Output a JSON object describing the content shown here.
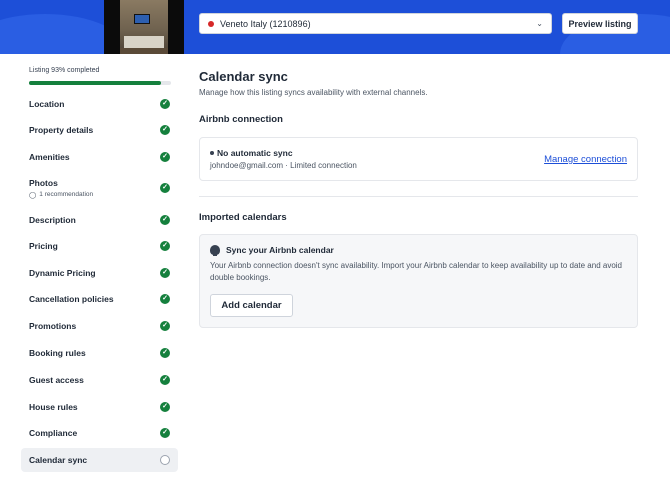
{
  "header": {
    "listing_select": {
      "value": "Veneto Italy (1210896)",
      "status_color": "#d62828"
    },
    "preview_label": "Preview listing",
    "brand_color": "#1d4fd8"
  },
  "sidebar": {
    "progress_label": "Listing 93% completed",
    "progress_fraction": 0.93,
    "items": [
      {
        "label": "Location",
        "status": "complete"
      },
      {
        "label": "Property details",
        "status": "complete"
      },
      {
        "label": "Amenities",
        "status": "complete"
      },
      {
        "label": "Photos",
        "sub": "1 recommendation",
        "status": "complete"
      },
      {
        "label": "Description",
        "status": "complete"
      },
      {
        "label": "Pricing",
        "status": "complete"
      },
      {
        "label": "Dynamic Pricing",
        "status": "complete"
      },
      {
        "label": "Cancellation policies",
        "status": "complete"
      },
      {
        "label": "Promotions",
        "status": "complete"
      },
      {
        "label": "Booking rules",
        "status": "complete"
      },
      {
        "label": "Guest access",
        "status": "complete"
      },
      {
        "label": "House rules",
        "status": "complete"
      },
      {
        "label": "Compliance",
        "status": "complete"
      },
      {
        "label": "Calendar sync",
        "status": "incomplete",
        "active": true
      }
    ]
  },
  "main": {
    "title": "Calendar sync",
    "subtitle": "Manage how this listing syncs availability with external channels.",
    "airbnb": {
      "heading": "Airbnb connection",
      "status": "No automatic sync",
      "detail": "johndoe@gmail.com · Limited connection",
      "manage_label": "Manage connection"
    },
    "imported": {
      "heading": "Imported calendars",
      "card_title": "Sync your Airbnb calendar",
      "card_body": "Your Airbnb connection doesn't sync availability. Import your Airbnb calendar to keep availability up to date and avoid double bookings.",
      "add_label": "Add calendar"
    }
  }
}
